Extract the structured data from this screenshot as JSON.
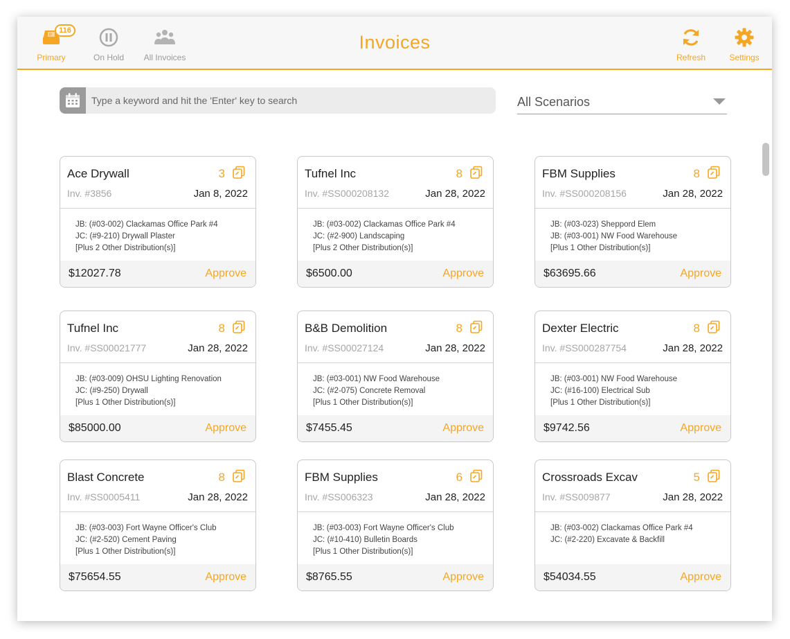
{
  "header": {
    "title": "Invoices",
    "nav": [
      {
        "label": "Primary",
        "badge": "116",
        "icon": "inbox-tray-icon",
        "active": true
      },
      {
        "label": "On Hold",
        "icon": "pause-icon",
        "active": false
      },
      {
        "label": "All Invoices",
        "icon": "people-group-icon",
        "active": false
      }
    ],
    "actions": [
      {
        "label": "Refresh",
        "icon": "refresh-icon"
      },
      {
        "label": "Settings",
        "icon": "gear-icon"
      }
    ]
  },
  "search": {
    "placeholder": "Type a keyword and hit the 'Enter' key to search",
    "icon": "calendar-icon"
  },
  "scenario": {
    "selected": "All Scenarios"
  },
  "colors": {
    "accent": "#f5a623",
    "muted": "#9b9b9b"
  },
  "invoices": [
    {
      "vendor": "Ace Drywall",
      "count": "3",
      "inv": "Inv. #3856",
      "date": "Jan 8, 2022",
      "lines": [
        "JB: (#03-002) Clackamas Office Park #4",
        "JC: (#9-210) Drywall Plaster",
        "[Plus 2 Other Distribution(s)]"
      ],
      "amount": "$12027.78",
      "action": "Approve"
    },
    {
      "vendor": "Tufnel Inc",
      "count": "8",
      "inv": "Inv. #SS000208132",
      "date": "Jan 28, 2022",
      "lines": [
        "JB: (#03-002) Clackamas Office Park #4",
        "JC: (#2-900) Landscaping",
        "[Plus 2 Other Distribution(s)]"
      ],
      "amount": "$6500.00",
      "action": "Approve"
    },
    {
      "vendor": "FBM Supplies",
      "count": "8",
      "inv": "Inv. #SS000208156",
      "date": "Jan 28, 2022",
      "lines": [
        "JB: (#03-023) Sheppord Elem",
        "JB: (#03-001) NW Food Warehouse",
        "[Plus 1 Other Distribution(s)]"
      ],
      "amount": "$63695.66",
      "action": "Approve"
    },
    {
      "vendor": "Tufnel Inc",
      "count": "8",
      "inv": "Inv. #SS00021777",
      "date": "Jan 28, 2022",
      "lines": [
        "JB: (#03-009) OHSU Lighting Renovation",
        "JC: (#9-250) Drywall",
        "[Plus 1 Other Distribution(s)]"
      ],
      "amount": "$85000.00",
      "action": "Approve"
    },
    {
      "vendor": "B&B Demolition",
      "count": "8",
      "inv": "Inv. #SS00027124",
      "date": "Jan 28, 2022",
      "lines": [
        "JB: (#03-001) NW Food Warehouse",
        "JC: (#2-075) Concrete Removal",
        "[Plus 1 Other Distribution(s)]"
      ],
      "amount": "$7455.45",
      "action": "Approve"
    },
    {
      "vendor": "Dexter Electric",
      "count": "8",
      "inv": "Inv. #SS000287754",
      "date": "Jan 28, 2022",
      "lines": [
        "JB: (#03-001) NW Food Warehouse",
        "JC: (#16-100) Electrical Sub",
        "[Plus 1 Other Distribution(s)]"
      ],
      "amount": "$9742.56",
      "action": "Approve"
    },
    {
      "vendor": "Blast Concrete",
      "count": "8",
      "inv": "Inv. #SS0005411",
      "date": "Jan 28, 2022",
      "lines": [
        "JB: (#03-003) Fort Wayne Officer's Club",
        "JC: (#2-520) Cement Paving",
        "[Plus 1 Other Distribution(s)]"
      ],
      "amount": "$75654.55",
      "action": "Approve"
    },
    {
      "vendor": "FBM Supplies",
      "count": "6",
      "inv": "Inv. #SS006323",
      "date": "Jan 28, 2022",
      "lines": [
        "JB: (#03-003) Fort Wayne Officer's Club",
        "JC: (#10-410) Bulletin Boards",
        "[Plus 1 Other Distribution(s)]"
      ],
      "amount": "$8765.55",
      "action": "Approve"
    },
    {
      "vendor": "Crossroads Excav",
      "count": "5",
      "inv": "Inv. #SS009877",
      "date": "Jan 28, 2022",
      "lines": [
        "JB: (#03-002) Clackamas Office Park #4",
        "JC: (#2-220) Excavate & Backfill"
      ],
      "amount": "$54034.55",
      "action": "Approve"
    }
  ]
}
